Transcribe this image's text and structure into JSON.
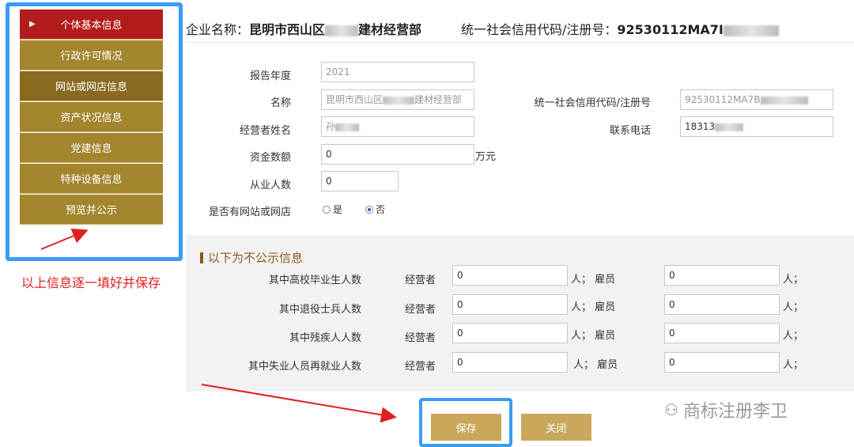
{
  "sidebar": {
    "items": [
      {
        "label": "个体基本信息"
      },
      {
        "label": "行政许可情况"
      },
      {
        "label": "网站或网店信息"
      },
      {
        "label": "资产状况信息"
      },
      {
        "label": "党建信息"
      },
      {
        "label": "特种设备信息"
      },
      {
        "label": "预览并公示"
      }
    ]
  },
  "hint": "以上信息逐一填好并保存",
  "header": {
    "company_label": "企业名称：",
    "company_value_a": "昆明市西山区",
    "company_value_b": "建材经营部",
    "code_label": "统一社会信用代码/注册号：",
    "code_value": "92530112MA7I"
  },
  "form": {
    "year_label": "报告年度",
    "year_value": "2021",
    "name_label": "名称",
    "name_value_a": "昆明市西山区",
    "name_value_b": "建材经营部",
    "credit_label": "统一社会信用代码/注册号",
    "credit_value": "92530112MA7B",
    "operator_label": "经营者姓名",
    "operator_value": "孙",
    "phone_label": "联系电话",
    "phone_value": "18313",
    "capital_label": "资金数额",
    "capital_value": "0",
    "capital_unit": "万元",
    "staff_label": "从业人数",
    "staff_value": "0",
    "website_label": "是否有网站或网店",
    "radio_yes": "是",
    "radio_no": "否"
  },
  "private": {
    "title": "以下为不公示信息",
    "operator_word": "经营者",
    "employee_word": "人；  雇员",
    "person_unit": "人；",
    "rows": [
      {
        "label": "其中高校毕业生人数",
        "op": "0",
        "emp": "0"
      },
      {
        "label": "其中退役士兵人数",
        "op": "0",
        "emp": "0"
      },
      {
        "label": "其中残疾人人数",
        "op": "0",
        "emp": "0"
      },
      {
        "label": "其中失业人员再就业人数",
        "op": "0",
        "emp": "0"
      }
    ]
  },
  "buttons": {
    "save": "保存",
    "close": "关闭"
  },
  "watermark": "商标注册李卫",
  "colors": {
    "accent_blue": "#3a9cf2",
    "active_red": "#b31c1c",
    "gold": "#a3852e",
    "button_gold": "#c9a85c",
    "hint_red": "#e02020"
  }
}
